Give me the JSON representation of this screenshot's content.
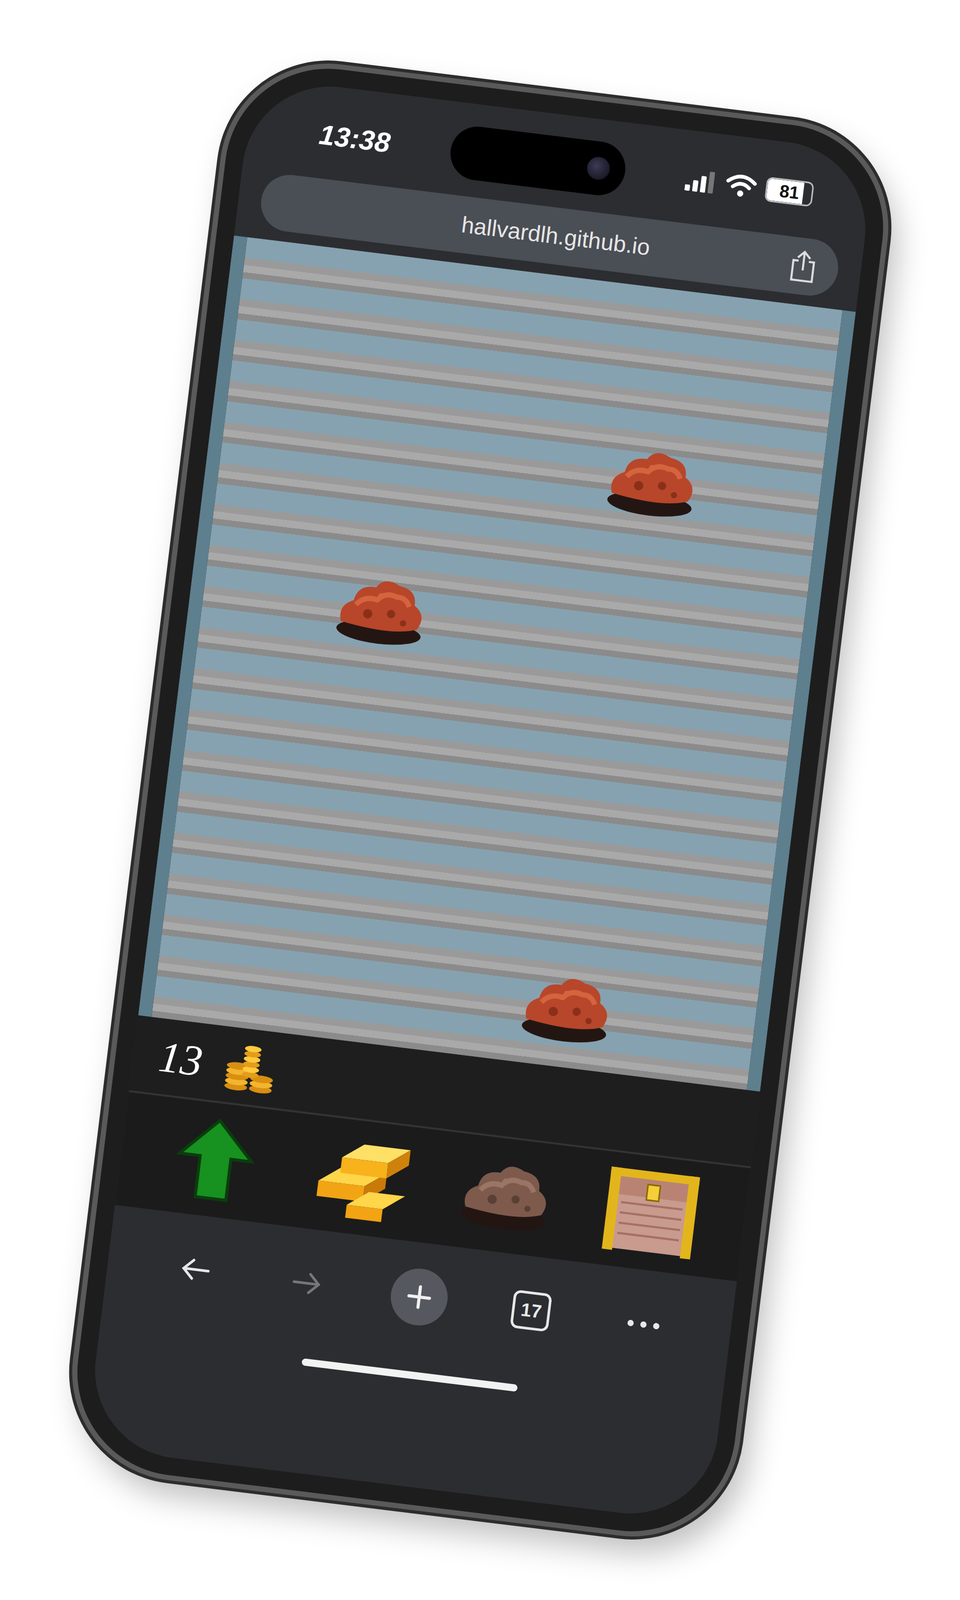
{
  "status_bar": {
    "time": "13:38",
    "battery": "81",
    "battery_level": 0.81,
    "signal_level": 0.75
  },
  "address_bar": {
    "url": "hallvardlh.github.io"
  },
  "game": {
    "ores": [
      {
        "kind": "copper-ore"
      },
      {
        "kind": "copper-ore"
      },
      {
        "kind": "copper-ore"
      }
    ],
    "coins": "13"
  },
  "toolbar": [
    {
      "kind": "upgrade"
    },
    {
      "kind": "gold"
    },
    {
      "kind": "ore"
    },
    {
      "kind": "chest"
    }
  ],
  "browser_bar": {
    "tab_count": "17",
    "back_enabled": true,
    "forward_enabled": false
  }
}
